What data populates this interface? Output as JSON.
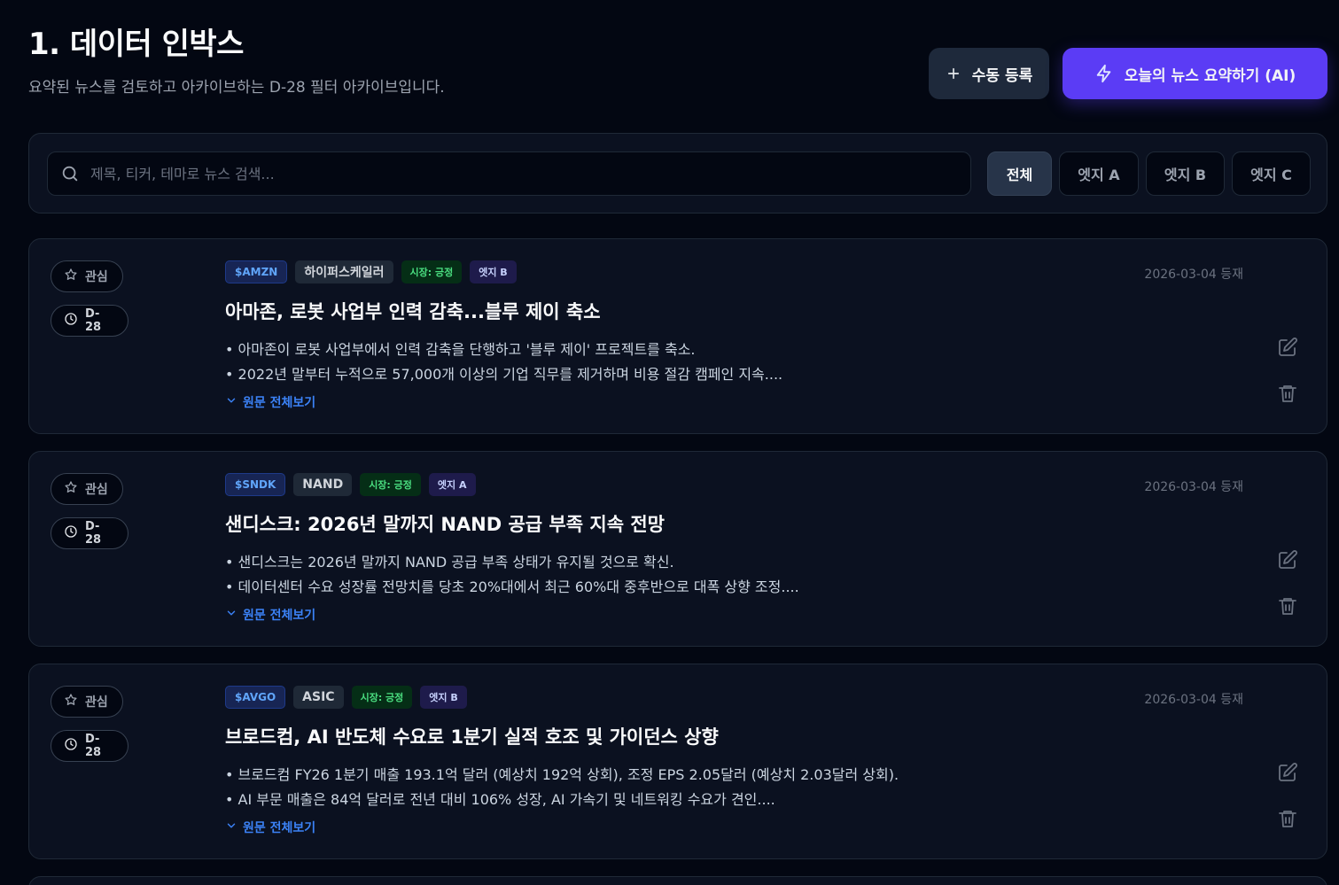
{
  "page": {
    "title": "1. 데이터 인박스",
    "subtitle": "요약된 뉴스를 검토하고 아카이브하는 D-28 필터 아카이브입니다."
  },
  "header_buttons": {
    "manual_label": "수동 등록",
    "ai_label": "오늘의 뉴스 요약하기 (AI)",
    "ai_color": "#5b3cf5"
  },
  "search": {
    "placeholder": "제목, 티커, 테마로 뉴스 검색...",
    "value": ""
  },
  "filters": [
    {
      "label": "전체",
      "active": true
    },
    {
      "label": "엣지 A",
      "active": false
    },
    {
      "label": "엣지 B",
      "active": false
    },
    {
      "label": "엣지 C",
      "active": false
    }
  ],
  "cards": [
    {
      "watch_label": "관심",
      "dday": "D-28",
      "ticker": "$AMZN",
      "theme": "하이퍼스케일러",
      "market": "시장: 긍정",
      "edge": "엣지 B",
      "date": "2026-03-04 등재",
      "title": "아마존, 로봇 사업부 인력 감축...블루 제이 축소",
      "bullets": [
        "• 아마존이 로봇 사업부에서 인력 감축을 단행하고 '블루 제이' 프로젝트를 축소.",
        "• 2022년 말부터 누적으로 57,000개 이상의 기업 직무를 제거하며 비용 절감 캠페인 지속...."
      ],
      "expand_label": "원문 전체보기"
    },
    {
      "watch_label": "관심",
      "dday": "D-28",
      "ticker": "$SNDK",
      "theme": "NAND",
      "market": "시장: 긍정",
      "edge": "엣지 A",
      "date": "2026-03-04 등재",
      "title": "샌디스크: 2026년 말까지 NAND 공급 부족 지속 전망",
      "bullets": [
        "• 샌디스크는 2026년 말까지 NAND 공급 부족 상태가 유지될 것으로 확신.",
        "• 데이터센터 수요 성장률 전망치를 당초 20%대에서 최근 60%대 중후반으로 대폭 상향 조정...."
      ],
      "expand_label": "원문 전체보기"
    },
    {
      "watch_label": "관심",
      "dday": "D-28",
      "ticker": "$AVGO",
      "theme": "ASIC",
      "market": "시장: 긍정",
      "edge": "엣지 B",
      "date": "2026-03-04 등재",
      "title": "브로드컴, AI 반도체 수요로 1분기 실적 호조 및 가이던스 상향",
      "bullets": [
        "• 브로드컴 FY26 1분기 매출 193.1억 달러 (예상치 192억 상회), 조정 EPS 2.05달러 (예상치 2.03달러 상회).",
        "• AI 부문 매출은 84억 달러로 전년 대비 106% 성장, AI 가속기 및 네트워킹 수요가 견인...."
      ],
      "expand_label": "원문 전체보기"
    }
  ]
}
